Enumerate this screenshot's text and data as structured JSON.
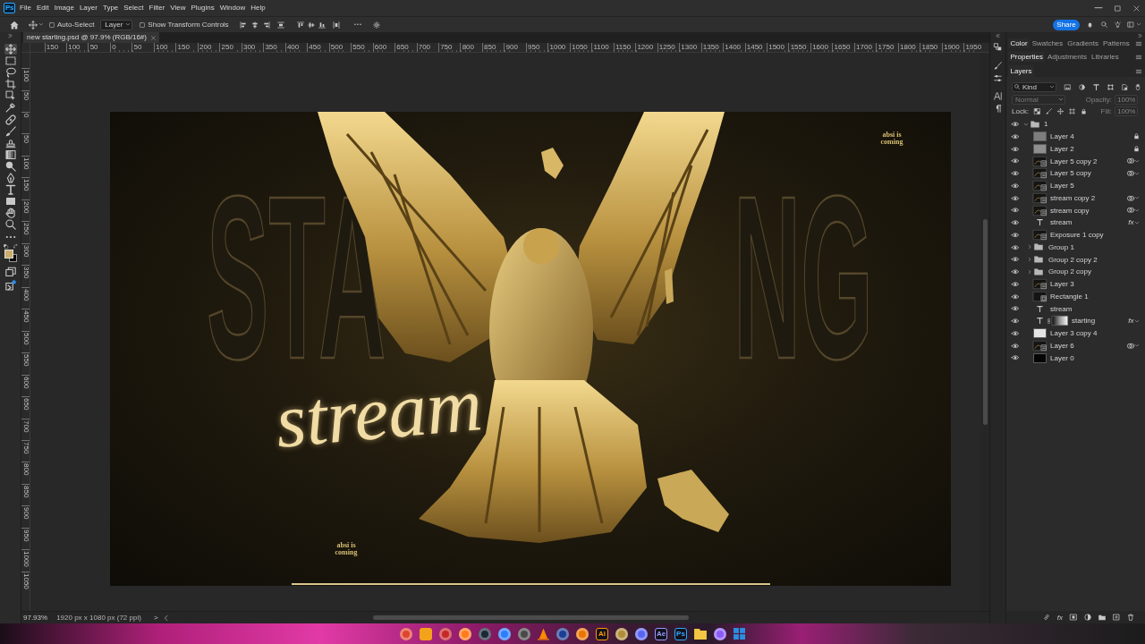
{
  "app": {
    "logo": "Ps",
    "menu": [
      "File",
      "Edit",
      "Image",
      "Layer",
      "Type",
      "Select",
      "Filter",
      "View",
      "Plugins",
      "Window",
      "Help"
    ]
  },
  "options_bar": {
    "auto_select": {
      "label": "Auto-Select",
      "checked": false
    },
    "target": {
      "value": "Layer"
    },
    "transform_controls": {
      "label": "Show Transform Controls",
      "checked": false
    },
    "share": "Share"
  },
  "toolbar": {
    "tools": [
      {
        "kind": "move",
        "selected": true
      },
      {
        "kind": "marquee",
        "selected": false
      },
      {
        "kind": "lasso",
        "selected": false
      },
      {
        "kind": "crop",
        "selected": false
      },
      {
        "kind": "object_select",
        "selected": false
      },
      {
        "kind": "eyedropper",
        "selected": false
      },
      {
        "kind": "healing",
        "selected": false
      },
      {
        "kind": "brush",
        "selected": false
      },
      {
        "kind": "stamp",
        "selected": false
      },
      {
        "kind": "gradient",
        "selected": false
      },
      {
        "kind": "dodge",
        "selected": false
      },
      {
        "kind": "pen",
        "selected": false
      },
      {
        "kind": "type",
        "selected": false
      },
      {
        "kind": "shape",
        "selected": false
      },
      {
        "kind": "hand",
        "selected": false
      },
      {
        "kind": "zoom",
        "selected": false
      },
      {
        "kind": "more",
        "selected": false
      }
    ],
    "mode_tools": [
      {
        "kind": "frames",
        "selected": false
      },
      {
        "kind": "frame_dot",
        "selected": false
      }
    ]
  },
  "document": {
    "tab": "new starting.psd @ 97.9% (RGB/16#)",
    "rulers": {
      "horizontal": [
        "150",
        "100",
        "50",
        "0",
        "50",
        "100",
        "150",
        "200",
        "250",
        "300",
        "350",
        "400",
        "450",
        "500",
        "550",
        "600",
        "650",
        "700",
        "750",
        "800",
        "850",
        "900",
        "950",
        "1000",
        "1050",
        "1100",
        "1150",
        "1200",
        "1250",
        "1300",
        "1350",
        "1400",
        "1450",
        "1500",
        "1550",
        "1600",
        "1650",
        "1700",
        "1750",
        "1800",
        "1850",
        "1900",
        "1950"
      ],
      "vertical": [
        "100",
        "50",
        "0",
        "50",
        "100",
        "150",
        "200",
        "250",
        "300",
        "350",
        "400",
        "450",
        "500",
        "550",
        "600",
        "650",
        "700",
        "750",
        "800",
        "850",
        "900",
        "950",
        "1000",
        "1050"
      ]
    },
    "artwork": {
      "outline_left": "STA",
      "outline_right": "NG",
      "script": "stream",
      "tagline_top": "absi is coming",
      "tagline_bottom": "absi is coming"
    }
  },
  "status_bar": {
    "zoom": "97.93%",
    "size": "1920 px x 1080 px (72 ppi)",
    "expand": ">"
  },
  "side_icons": [
    {
      "kind": "history"
    },
    {
      "kind": "brush"
    },
    {
      "kind": "sliders"
    },
    {
      "kind": "character"
    },
    {
      "kind": "paragraph"
    }
  ],
  "panels": {
    "groups": [
      {
        "tabs": [
          {
            "label": "Color",
            "selected": true
          },
          {
            "label": "Swatches",
            "selected": false
          },
          {
            "label": "Gradients",
            "selected": false
          },
          {
            "label": "Patterns",
            "selected": false
          }
        ]
      },
      {
        "tabs": [
          {
            "label": "Properties",
            "selected": true
          },
          {
            "label": "Adjustments",
            "selected": false
          },
          {
            "label": "Libraries",
            "selected": false
          }
        ]
      },
      {
        "tabs": [
          {
            "label": "Layers",
            "selected": true
          }
        ]
      }
    ],
    "layers": {
      "filter": "Kind",
      "blend": {
        "value": "Normal",
        "disabled": true
      },
      "opacity": {
        "label": "Opacity:",
        "value": "100%",
        "disabled": true
      },
      "lock_label": "Lock:",
      "fill": {
        "label": "Fill:",
        "value": "100%",
        "disabled": true
      },
      "footer_effects": "fx",
      "items": [
        {
          "name": "1",
          "kind": "group",
          "expanded": true,
          "visible": true,
          "selected": false,
          "locked": false,
          "smart_filters": false,
          "mask": false,
          "children": [
            {
              "name": "Layer 4",
              "kind": "pixel",
              "color": "#7d7d7d",
              "visible": true,
              "selected": false,
              "locked": true,
              "smart_filters": false,
              "mask": false
            },
            {
              "name": "Layer 2",
              "kind": "pixel",
              "color": "#8f8f8f",
              "visible": true,
              "selected": false,
              "locked": true,
              "smart_filters": false,
              "mask": false
            },
            {
              "name": "Layer 5 copy 2",
              "kind": "smart",
              "visible": true,
              "selected": false,
              "locked": false,
              "smart_filters": true,
              "mask": false
            },
            {
              "name": "Layer 5 copy",
              "kind": "smart",
              "visible": true,
              "selected": false,
              "locked": false,
              "smart_filters": true,
              "mask": false
            },
            {
              "name": "Layer 5",
              "kind": "smart",
              "visible": true,
              "selected": false,
              "locked": false,
              "smart_filters": false,
              "mask": false
            },
            {
              "name": "stream copy 2",
              "kind": "smart",
              "visible": true,
              "selected": false,
              "locked": false,
              "smart_filters": true,
              "mask": false
            },
            {
              "name": "stream copy",
              "kind": "smart",
              "visible": true,
              "selected": false,
              "locked": false,
              "smart_filters": true,
              "mask": false
            },
            {
              "name": "stream",
              "kind": "text",
              "effects": "fx",
              "visible": true,
              "selected": false,
              "locked": false,
              "smart_filters": false,
              "mask": false
            },
            {
              "name": "Exposure 1 copy",
              "kind": "smart",
              "visible": true,
              "selected": false,
              "locked": false,
              "smart_filters": false,
              "mask": false
            },
            {
              "name": "Group 1",
              "kind": "group",
              "expanded": false,
              "visible": true,
              "selected": false,
              "locked": false,
              "smart_filters": false,
              "mask": false
            },
            {
              "name": "Group 2 copy 2",
              "kind": "group",
              "expanded": false,
              "visible": true,
              "selected": false,
              "locked": false,
              "smart_filters": false,
              "mask": false
            },
            {
              "name": "Group 2 copy",
              "kind": "group",
              "expanded": false,
              "visible": true,
              "selected": false,
              "locked": false,
              "smart_filters": false,
              "mask": false
            },
            {
              "name": "Layer 3",
              "kind": "smart",
              "visible": true,
              "selected": false,
              "locked": false,
              "smart_filters": false,
              "mask": false
            },
            {
              "name": "Rectangle 1",
              "kind": "shape",
              "visible": true,
              "selected": false,
              "locked": false,
              "smart_filters": false,
              "mask": false
            },
            {
              "name": "stream",
              "kind": "text",
              "visible": true,
              "selected": false,
              "locked": false,
              "smart_filters": false,
              "mask": false
            },
            {
              "name": "starting",
              "kind": "text",
              "effects": "fx",
              "visible": true,
              "selected": false,
              "locked": false,
              "smart_filters": false,
              "mask": true
            },
            {
              "name": "Layer 3 copy 4",
              "kind": "pixel",
              "color": "#e4e4e4",
              "visible": true,
              "selected": false,
              "locked": false,
              "smart_filters": false,
              "mask": false
            },
            {
              "name": "Layer 6",
              "kind": "smart",
              "visible": true,
              "selected": false,
              "locked": false,
              "smart_filters": true,
              "mask": false
            },
            {
              "name": "Layer 0",
              "kind": "pixel",
              "color": "#050505",
              "visible": true,
              "selected": false,
              "locked": false,
              "smart_filters": false,
              "mask": false
            }
          ]
        }
      ]
    }
  },
  "taskbar": {
    "apps": [
      {
        "kind": "round",
        "color": "#e0452f"
      },
      {
        "kind": "square",
        "color": "#f2a31b"
      },
      {
        "kind": "round",
        "color": "#c62828"
      },
      {
        "kind": "round",
        "color": "#ff7a1a"
      },
      {
        "kind": "round",
        "color": "#1b2838"
      },
      {
        "kind": "round",
        "color": "#2d7ff9"
      },
      {
        "kind": "round",
        "color": "#4a4a4a"
      },
      {
        "kind": "cone",
        "color": "#ff8800"
      },
      {
        "kind": "round",
        "color": "#1c3f94"
      },
      {
        "kind": "round",
        "color": "#ea7600"
      },
      {
        "kind": "label",
        "label": "Ai",
        "color": "#ff9a00"
      },
      {
        "kind": "round",
        "color": "#b08d3a"
      },
      {
        "kind": "round",
        "color": "#5865f2"
      },
      {
        "kind": "label",
        "label": "Ae",
        "color": "#9999ff"
      },
      {
        "kind": "label",
        "label": "Ps",
        "color": "#31a8ff"
      },
      {
        "kind": "folder",
        "color": "#f4c542"
      },
      {
        "kind": "round",
        "color": "#8b5cf6"
      },
      {
        "kind": "grid",
        "color": "#2b8de0"
      }
    ]
  }
}
